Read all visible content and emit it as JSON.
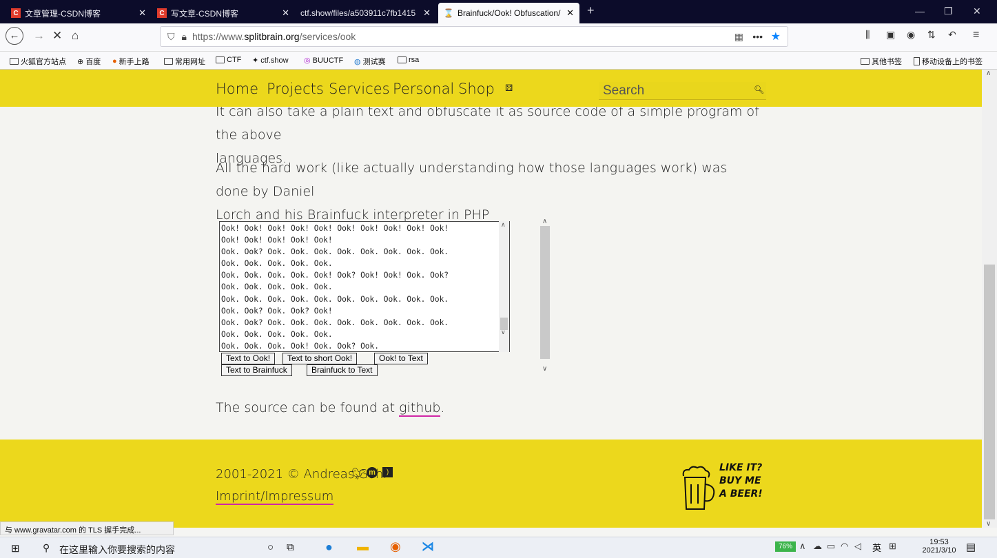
{
  "browser": {
    "tabs": [
      {
        "label": "文章管理-CSDN博客",
        "icon": "csdn-icon"
      },
      {
        "label": "写文章-CSDN博客",
        "icon": "csdn-icon"
      },
      {
        "label": "ctf.show/files/a503911c7fb1415",
        "icon": ""
      },
      {
        "label": "Brainfuck/Ook! Obfuscation/",
        "icon": "hourglass-icon"
      }
    ],
    "url": "https://www.splitbrain.org/services/ook",
    "url_prefix": "https://www.",
    "url_domain": "splitbrain.org",
    "url_path": "/services/ook",
    "bookmarks": [
      {
        "label": "火狐官方站点",
        "icon": "folder-icon"
      },
      {
        "label": "百度",
        "icon": "globe-icon"
      },
      {
        "label": "新手上路",
        "icon": "firefox-icon"
      },
      {
        "label": "常用网址",
        "icon": "folder-icon"
      },
      {
        "label": "CTF",
        "icon": "folder-icon"
      },
      {
        "label": "ctf.show",
        "icon": "figure-icon"
      },
      {
        "label": "BUUCTF",
        "icon": "buuctf-icon"
      },
      {
        "label": "测试赛",
        "icon": "circle-icon"
      },
      {
        "label": "rsa",
        "icon": "folder-icon"
      }
    ],
    "other_bookmarks": "其他书签",
    "mobile_bookmarks": "移动设备上的书签",
    "status_text": "与 www.gravatar.com 的 TLS 握手完成..."
  },
  "site": {
    "menu": [
      "Home",
      "Projects",
      "Services",
      "Personal",
      "Shop"
    ],
    "search_placeholder": "Search",
    "para1_line1": "It can also take a plain text and obfuscate it as source code of a simple program of the above",
    "para1_line2": "languages.",
    "para2_line1": "All the hard work (like actually understanding how those languages work) was done by Daniel",
    "para2_line2_prefix": "Lorch and his ",
    "para2_link": "Brainfuck interpreter in PHP",
    "textarea_lines": [
      "Ook! Ook! Ook! Ook! Ook! Ook! Ook! Ook! Ook! Ook!",
      "Ook! Ook! Ook! Ook! Ook!",
      "Ook. Ook? Ook. Ook. Ook. Ook. Ook. Ook. Ook. Ook.",
      "Ook. Ook. Ook. Ook. Ook.",
      "Ook. Ook. Ook. Ook. Ook! Ook? Ook! Ook! Ook. Ook?",
      "Ook. Ook. Ook. Ook. Ook.",
      "Ook. Ook. Ook. Ook. Ook. Ook. Ook. Ook. Ook. Ook.",
      "Ook. Ook? Ook. Ook? Ook!",
      "Ook. Ook? Ook. Ook. Ook. Ook. Ook. Ook. Ook. Ook.",
      "Ook. Ook. Ook. Ook. Ook.",
      "Ook. Ook. Ook. Ook! Ook. Ook? Ook."
    ],
    "buttons": {
      "text_to_ook": "Text to Ook!",
      "text_to_short_ook": "Text to short Ook!",
      "ook_to_text": "Ook! to Text",
      "text_to_brainfuck": "Text to Brainfuck",
      "brainfuck_to_text": "Brainfuck to Text"
    },
    "source_prefix": "The source can be found at ",
    "source_link": "github",
    "source_suffix": ".",
    "footer_copyright": "2001-2021 © Andreas Gohr",
    "footer_imprint": "Imprint/Impressum",
    "beer_line1": "LIKE IT?",
    "beer_line2": "BUY ME",
    "beer_line3": "A BEER!"
  },
  "taskbar": {
    "search_placeholder": "在这里输入你要搜索的内容",
    "battery": "76%",
    "ime_lang": "英",
    "time": "19:53",
    "date": "2021/3/10"
  }
}
